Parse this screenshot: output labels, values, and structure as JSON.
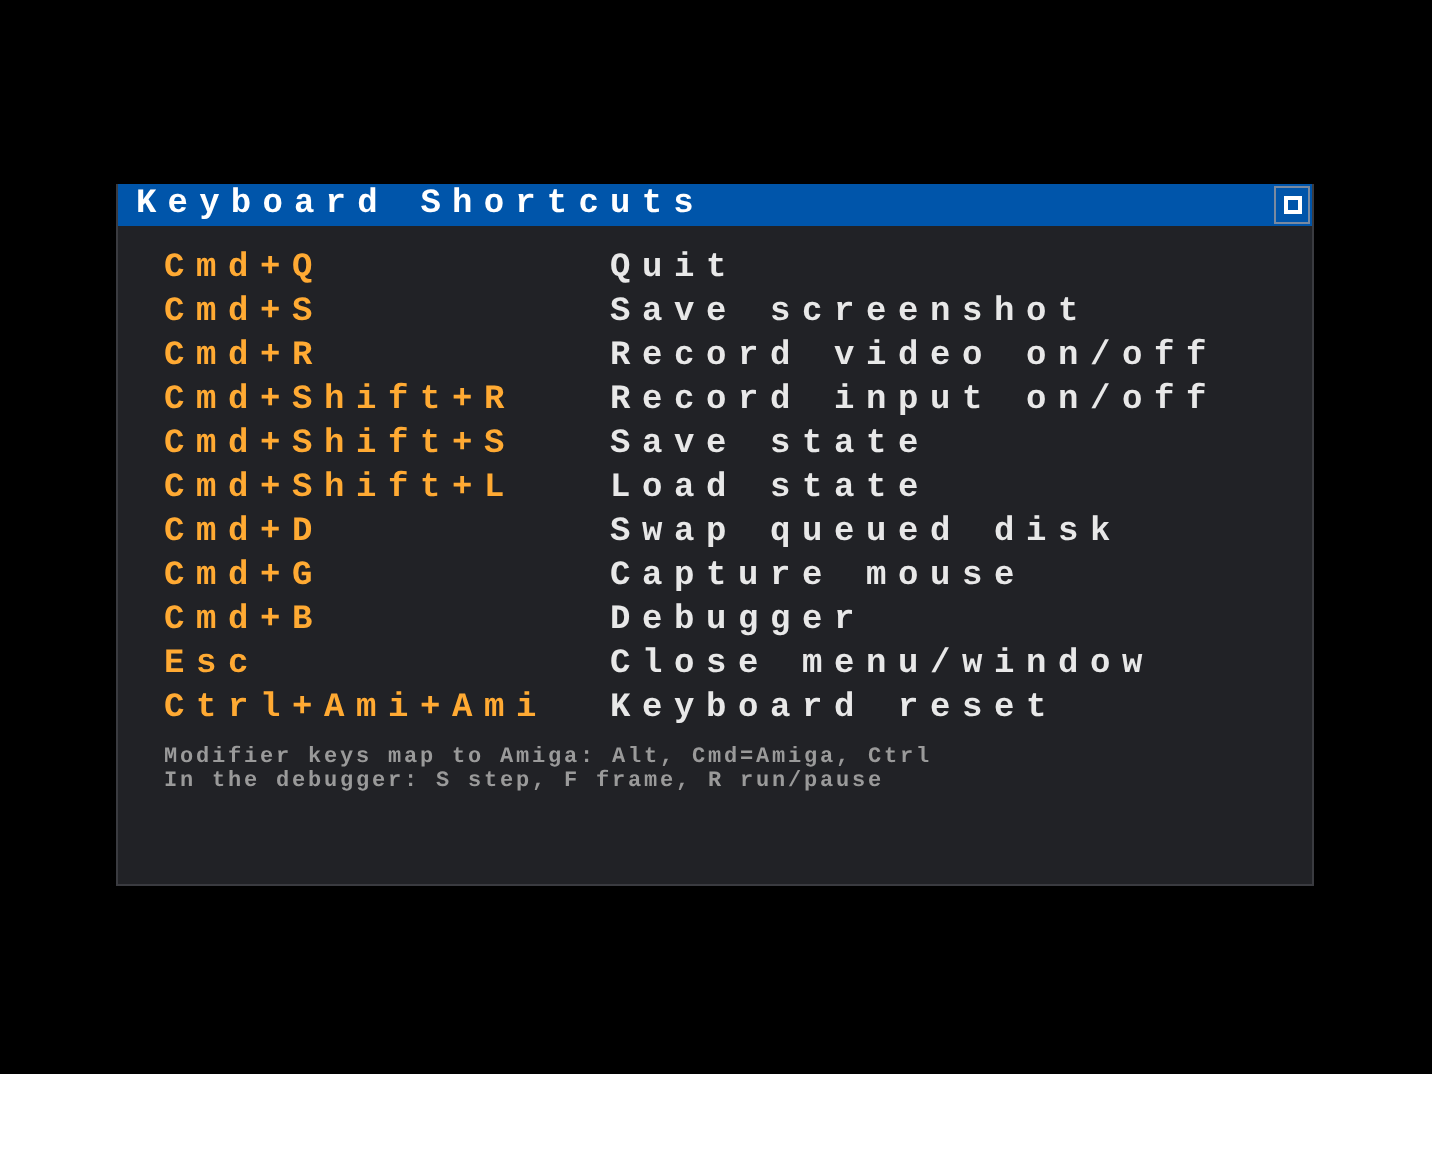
{
  "window": {
    "title": "Keyboard Shortcuts"
  },
  "shortcuts": [
    {
      "keys": "Cmd+Q",
      "action": "Quit"
    },
    {
      "keys": "Cmd+S",
      "action": "Save screenshot"
    },
    {
      "keys": "Cmd+R",
      "action": "Record video on/off"
    },
    {
      "keys": "Cmd+Shift+R",
      "action": "Record input on/off"
    },
    {
      "keys": "Cmd+Shift+S",
      "action": "Save state"
    },
    {
      "keys": "Cmd+Shift+L",
      "action": "Load state"
    },
    {
      "keys": "Cmd+D",
      "action": "Swap queued disk"
    },
    {
      "keys": "Cmd+G",
      "action": "Capture mouse"
    },
    {
      "keys": "Cmd+B",
      "action": "Debugger"
    },
    {
      "keys": "Esc",
      "action": "Close menu/window"
    },
    {
      "keys": "Ctrl+Ami+Ami",
      "action": "Keyboard reset"
    }
  ],
  "notes": [
    "Modifier keys map to Amiga: Alt, Cmd=Amiga, Ctrl",
    "In the debugger: S step, F frame, R run/pause"
  ]
}
